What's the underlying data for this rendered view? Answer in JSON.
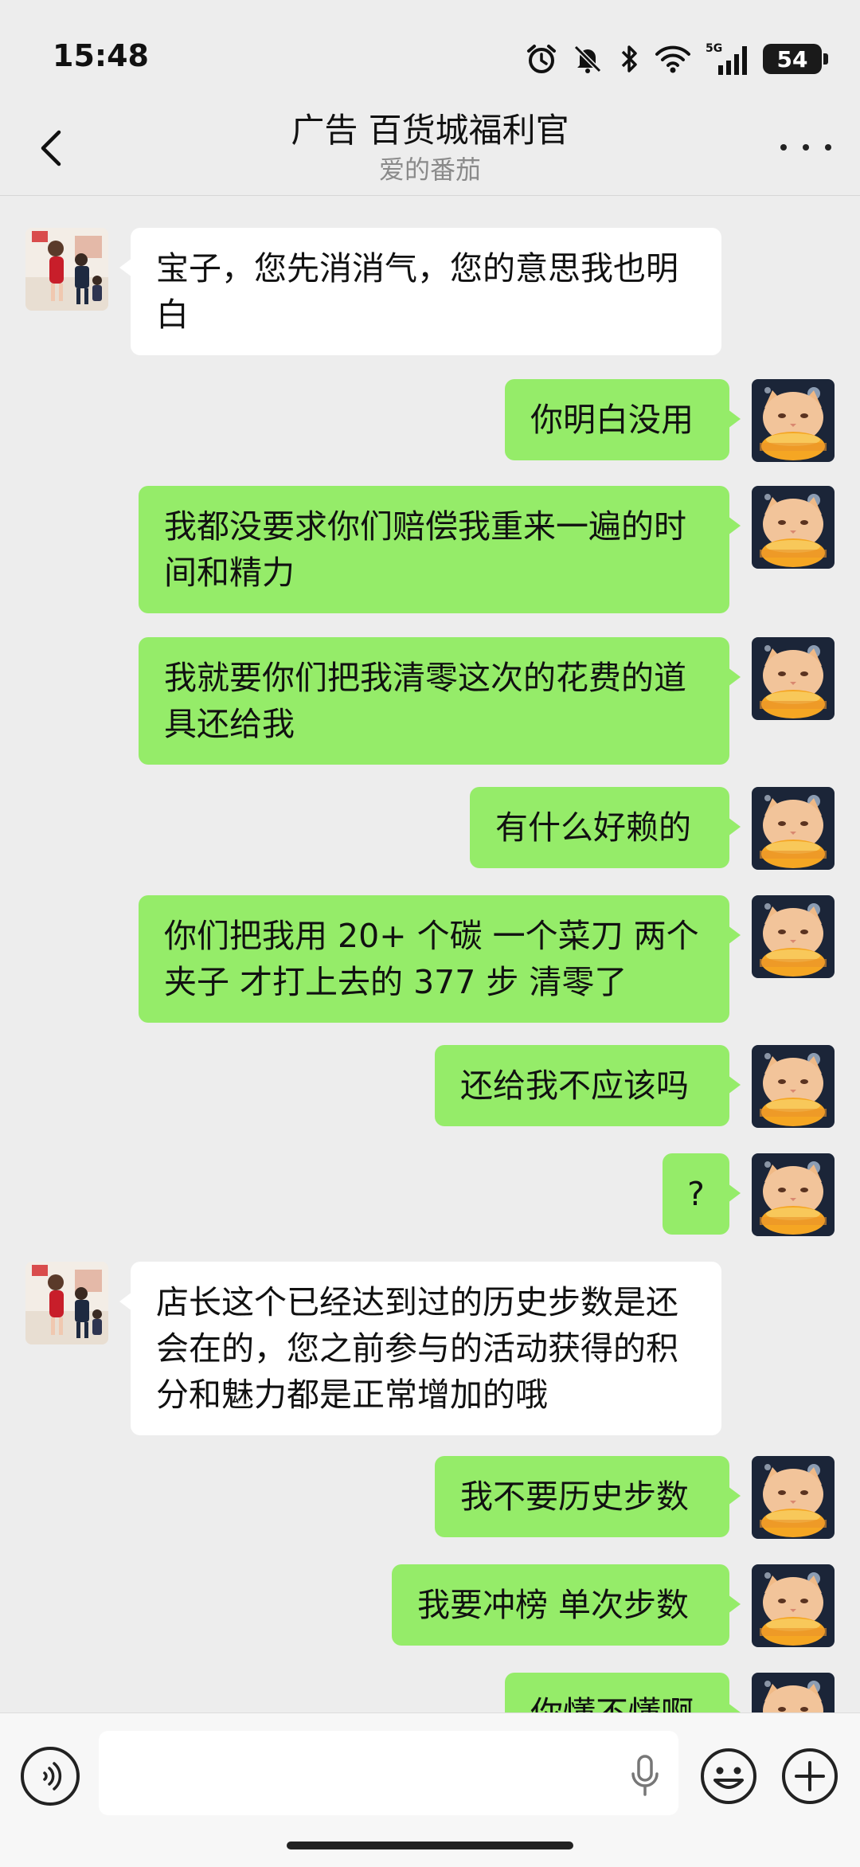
{
  "status_bar": {
    "time": "15:48",
    "network": "5G",
    "battery": "54",
    "icons": [
      "alarm-icon",
      "mute-icon",
      "bluetooth-icon",
      "wifi-icon",
      "signal-icon",
      "battery-icon"
    ]
  },
  "header": {
    "title": "广告 百货城福利官",
    "subtitle": "爱的番茄",
    "back_icon": "chevron-left-icon",
    "more_icon": "more-icon"
  },
  "messages": [
    {
      "side": "left",
      "text": "宝子，您先消消气，您的意思我也明白"
    },
    {
      "side": "right",
      "text": "你明白没用"
    },
    {
      "side": "right",
      "text": "我都没要求你们赔偿我重来一遍的时间和精力"
    },
    {
      "side": "right",
      "text": "我就要你们把我清零这次的花费的道具还给我"
    },
    {
      "side": "right",
      "text": "有什么好赖的"
    },
    {
      "side": "right",
      "text": "你们把我用 20+ 个碳 一个菜刀 两个夹子 才打上去的 377 步 清零了"
    },
    {
      "side": "right",
      "text": "还给我不应该吗"
    },
    {
      "side": "right",
      "text": "?"
    },
    {
      "side": "left",
      "text": "店长这个已经达到过的历史步数是还会在的，您之前参与的活动获得的积分和魅力都是正常增加的哦"
    },
    {
      "side": "right",
      "text": "我不要历史步数"
    },
    {
      "side": "right",
      "text": "我要冲榜 单次步数"
    },
    {
      "side": "right",
      "text": "你懂不懂啊"
    }
  ],
  "input_bar": {
    "value": "",
    "voice_icon": "voice-icon",
    "mic_icon": "microphone-icon",
    "emoji_icon": "emoji-icon",
    "plus_icon": "plus-icon"
  },
  "colors": {
    "background": "#ededed",
    "bubble_sent": "#95ec69",
    "bubble_received": "#ffffff"
  }
}
